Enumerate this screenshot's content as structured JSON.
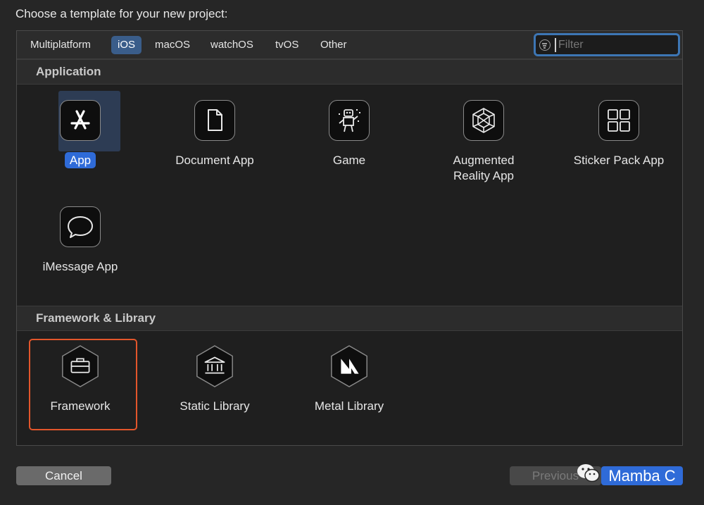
{
  "header": {
    "prompt": "Choose a template for your new project:"
  },
  "platform_tabs": [
    {
      "label": "Multiplatform",
      "active": false
    },
    {
      "label": "iOS",
      "active": true
    },
    {
      "label": "macOS",
      "active": false
    },
    {
      "label": "watchOS",
      "active": false
    },
    {
      "label": "tvOS",
      "active": false
    },
    {
      "label": "Other",
      "active": false
    }
  ],
  "filter": {
    "placeholder": "Filter",
    "value": ""
  },
  "sections": {
    "application": {
      "title": "Application",
      "templates": [
        {
          "label": "App",
          "icon": "app-store-icon",
          "selected": true
        },
        {
          "label": "Document App",
          "icon": "document-icon",
          "selected": false
        },
        {
          "label": "Game",
          "icon": "game-robot-icon",
          "selected": false
        },
        {
          "label_line1": "Augmented",
          "label_line2": "Reality App",
          "icon": "ar-cube-icon",
          "selected": false
        },
        {
          "label": "Sticker Pack App",
          "icon": "sticker-grid-icon",
          "selected": false
        },
        {
          "label": "iMessage App",
          "icon": "message-bubble-icon",
          "selected": false
        }
      ]
    },
    "framework": {
      "title": "Framework & Library",
      "templates": [
        {
          "label": "Framework",
          "icon": "toolbox-icon",
          "highlighted": true
        },
        {
          "label": "Static Library",
          "icon": "library-building-icon",
          "highlighted": false
        },
        {
          "label": "Metal Library",
          "icon": "metal-m-icon",
          "highlighted": false
        }
      ]
    }
  },
  "footer": {
    "cancel_label": "Cancel",
    "previous_label": "Previous",
    "next_label": "Mamba C"
  },
  "colors": {
    "accent_blue": "#2f6bd8",
    "highlight_orange": "#e3562b",
    "background": "#262626"
  }
}
